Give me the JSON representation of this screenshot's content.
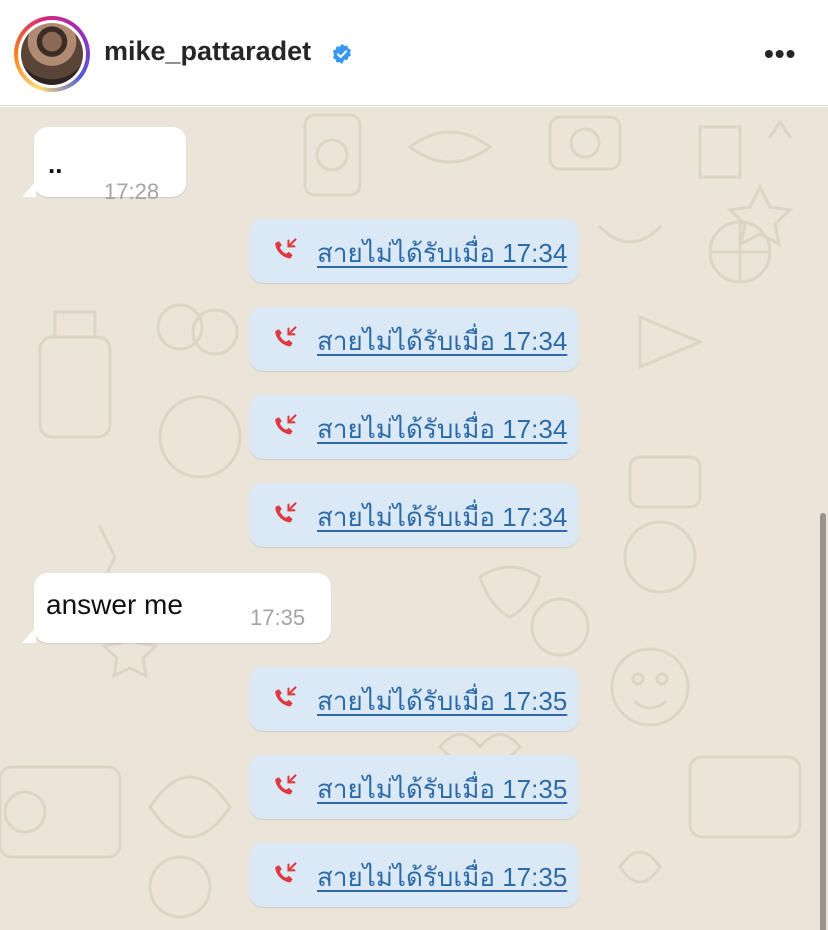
{
  "post_header": {
    "username": "mike_pattaradet",
    "verified": true,
    "more_label": "•••",
    "icons": [
      "avatar",
      "verified-badge-icon",
      "more-options-icon"
    ]
  },
  "chat": {
    "messages": [
      {
        "type": "incoming",
        "text": "..",
        "time": "17:28"
      },
      {
        "type": "missed-call",
        "label": "สายไม่ได้รับเมื่อ 17:34"
      },
      {
        "type": "missed-call",
        "label": "สายไม่ได้รับเมื่อ 17:34"
      },
      {
        "type": "missed-call",
        "label": "สายไม่ได้รับเมื่อ 17:34"
      },
      {
        "type": "missed-call",
        "label": "สายไม่ได้รับเมื่อ 17:34"
      },
      {
        "type": "incoming",
        "text": "answer me",
        "time": "17:35"
      },
      {
        "type": "missed-call",
        "label": "สายไม่ได้รับเมื่อ 17:35"
      },
      {
        "type": "missed-call",
        "label": "สายไม่ได้รับเมื่อ 17:35"
      },
      {
        "type": "missed-call",
        "label": "สายไม่ได้รับเมื่อ 17:35"
      }
    ],
    "colors": {
      "background": "#ebe4d9",
      "call_bubble": "#dbe9f7",
      "call_text": "#2d6ba8",
      "missed_call_icon": "#e0393e"
    }
  }
}
